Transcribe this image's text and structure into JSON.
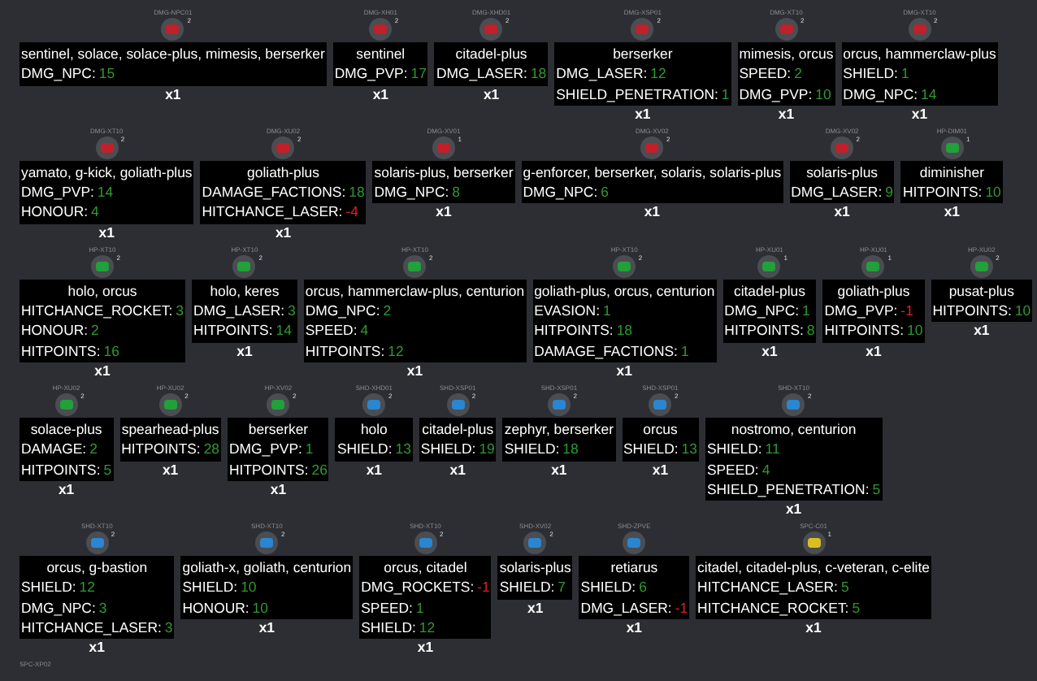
{
  "rows": [
    {
      "items": [
        {
          "code": "DMG-NPC01",
          "badge": "2",
          "color": "#c0202a",
          "title": "sentinel, solace, solace-plus, mimesis, berserker",
          "stats": [
            {
              "name": "DMG_NPC:",
              "value": "15",
              "negative": false
            }
          ],
          "quantity": "x1"
        },
        {
          "code": "DMG-XH01",
          "badge": "2",
          "color": "#c0202a",
          "title": "sentinel",
          "stats": [
            {
              "name": "DMG_PVP:",
              "value": "17",
              "negative": false
            }
          ],
          "quantity": "x1"
        },
        {
          "code": "DMG-XHD01",
          "badge": "2",
          "color": "#c0202a",
          "title": "citadel-plus",
          "stats": [
            {
              "name": "DMG_LASER:",
              "value": "18",
              "negative": false
            }
          ],
          "quantity": "x1"
        },
        {
          "code": "DMG-XSP01",
          "badge": "2",
          "color": "#c0202a",
          "title": "berserker",
          "stats": [
            {
              "name": "DMG_LASER:",
              "value": "12",
              "negative": false
            },
            {
              "name": "SHIELD_PENETRATION:",
              "value": "1",
              "negative": false
            }
          ],
          "quantity": "x1"
        },
        {
          "code": "DMG-XT10",
          "badge": "2",
          "color": "#c0202a",
          "title": "mimesis, orcus",
          "stats": [
            {
              "name": "SPEED:",
              "value": "2",
              "negative": false
            },
            {
              "name": "DMG_PVP:",
              "value": "10",
              "negative": false
            }
          ],
          "quantity": "x1"
        },
        {
          "code": "DMG-XT10",
          "badge": "2",
          "color": "#c0202a",
          "title": "orcus, hammerclaw-plus",
          "stats": [
            {
              "name": "SHIELD:",
              "value": "1",
              "negative": false
            },
            {
              "name": "DMG_NPC:",
              "value": "14",
              "negative": false
            }
          ],
          "quantity": "x1"
        }
      ]
    },
    {
      "items": [
        {
          "code": "DMG-XT10",
          "badge": "2",
          "color": "#c0202a",
          "title": "yamato, g-kick, goliath-plus",
          "stats": [
            {
              "name": "DMG_PVP:",
              "value": "14",
              "negative": false
            },
            {
              "name": "HONOUR:",
              "value": "4",
              "negative": false
            }
          ],
          "quantity": "x1"
        },
        {
          "code": "DMG-XU02",
          "badge": "2",
          "color": "#c0202a",
          "title": "goliath-plus",
          "stats": [
            {
              "name": "DAMAGE_FACTIONS:",
              "value": "18",
              "negative": false
            },
            {
              "name": "HITCHANCE_LASER:",
              "value": "-4",
              "negative": true
            }
          ],
          "quantity": "x1"
        },
        {
          "code": "DMG-XV01",
          "badge": "1",
          "color": "#c0202a",
          "title": "solaris-plus, berserker",
          "stats": [
            {
              "name": "DMG_NPC:",
              "value": "8",
              "negative": false
            }
          ],
          "quantity": "x1"
        },
        {
          "code": "DMG-XV02",
          "badge": "2",
          "color": "#c0202a",
          "title": "g-enforcer, berserker, solaris, solaris-plus",
          "stats": [
            {
              "name": "DMG_NPC:",
              "value": "6",
              "negative": false
            }
          ],
          "quantity": "x1"
        },
        {
          "code": "DMG-XV02",
          "badge": "2",
          "color": "#c0202a",
          "title": "solaris-plus",
          "stats": [
            {
              "name": "DMG_LASER:",
              "value": "9",
              "negative": false
            }
          ],
          "quantity": "x1"
        },
        {
          "code": "HP-DIM01",
          "badge": "1",
          "color": "#22a03a",
          "title": "diminisher",
          "stats": [
            {
              "name": "HITPOINTS:",
              "value": "10",
              "negative": false
            }
          ],
          "quantity": "x1"
        }
      ]
    },
    {
      "items": [
        {
          "code": "HP-XT10",
          "badge": "2",
          "color": "#22a03a",
          "title": "holo, orcus",
          "stats": [
            {
              "name": "HITCHANCE_ROCKET:",
              "value": "3",
              "negative": false
            },
            {
              "name": "HONOUR:",
              "value": "2",
              "negative": false
            },
            {
              "name": "HITPOINTS:",
              "value": "16",
              "negative": false
            }
          ],
          "quantity": "x1"
        },
        {
          "code": "HP-XT10",
          "badge": "2",
          "color": "#22a03a",
          "title": "holo, keres",
          "stats": [
            {
              "name": "DMG_LASER:",
              "value": "3",
              "negative": false
            },
            {
              "name": "HITPOINTS:",
              "value": "14",
              "negative": false
            }
          ],
          "quantity": "x1"
        },
        {
          "code": "HP-XT10",
          "badge": "2",
          "color": "#22a03a",
          "title": "orcus, hammerclaw-plus, centurion",
          "stats": [
            {
              "name": "DMG_NPC:",
              "value": "2",
              "negative": false
            },
            {
              "name": "SPEED:",
              "value": "4",
              "negative": false
            },
            {
              "name": "HITPOINTS:",
              "value": "12",
              "negative": false
            }
          ],
          "quantity": "x1"
        },
        {
          "code": "HP-XT10",
          "badge": "2",
          "color": "#22a03a",
          "title": "goliath-plus, orcus, centurion",
          "stats": [
            {
              "name": "EVASION:",
              "value": "1",
              "negative": false
            },
            {
              "name": "HITPOINTS:",
              "value": "18",
              "negative": false
            },
            {
              "name": "DAMAGE_FACTIONS:",
              "value": "1",
              "negative": false
            }
          ],
          "quantity": "x1"
        },
        {
          "code": "HP-XU01",
          "badge": "1",
          "color": "#22a03a",
          "title": "citadel-plus",
          "stats": [
            {
              "name": "DMG_NPC:",
              "value": "1",
              "negative": false
            },
            {
              "name": "HITPOINTS:",
              "value": "8",
              "negative": false
            }
          ],
          "quantity": "x1"
        },
        {
          "code": "HP-XU01",
          "badge": "1",
          "color": "#22a03a",
          "title": "goliath-plus",
          "stats": [
            {
              "name": "DMG_PVP:",
              "value": "-1",
              "negative": true
            },
            {
              "name": "HITPOINTS:",
              "value": "10",
              "negative": false
            }
          ],
          "quantity": "x1"
        },
        {
          "code": "HP-XU02",
          "badge": "2",
          "color": "#22a03a",
          "title": "pusat-plus",
          "stats": [
            {
              "name": "HITPOINTS:",
              "value": "10",
              "negative": false
            }
          ],
          "quantity": "x1"
        }
      ]
    },
    {
      "items": [
        {
          "code": "HP-XU02",
          "badge": "2",
          "color": "#22a03a",
          "title": "solace-plus",
          "stats": [
            {
              "name": "DAMAGE:",
              "value": "2",
              "negative": false
            },
            {
              "name": "HITPOINTS:",
              "value": "5",
              "negative": false
            }
          ],
          "quantity": "x1"
        },
        {
          "code": "HP-XU02",
          "badge": "2",
          "color": "#22a03a",
          "title": "spearhead-plus",
          "stats": [
            {
              "name": "HITPOINTS:",
              "value": "28",
              "negative": false
            }
          ],
          "quantity": "x1"
        },
        {
          "code": "HP-XV02",
          "badge": "2",
          "color": "#22a03a",
          "title": "berserker",
          "stats": [
            {
              "name": "DMG_PVP:",
              "value": "1",
              "negative": false
            },
            {
              "name": "HITPOINTS:",
              "value": "26",
              "negative": false
            }
          ],
          "quantity": "x1"
        },
        {
          "code": "SHD-XHD01",
          "badge": "2",
          "color": "#2a86d0",
          "title": "holo",
          "stats": [
            {
              "name": "SHIELD:",
              "value": "13",
              "negative": false
            }
          ],
          "quantity": "x1"
        },
        {
          "code": "SHD-XSP01",
          "badge": "2",
          "color": "#2a86d0",
          "title": "citadel-plus",
          "stats": [
            {
              "name": "SHIELD:",
              "value": "19",
              "negative": false
            }
          ],
          "quantity": "x1"
        },
        {
          "code": "SHD-XSP01",
          "badge": "2",
          "color": "#2a86d0",
          "title": "zephyr, berserker",
          "stats": [
            {
              "name": "SHIELD:",
              "value": "18",
              "negative": false
            }
          ],
          "quantity": "x1"
        },
        {
          "code": "SHD-XSP01",
          "badge": "2",
          "color": "#2a86d0",
          "title": "orcus",
          "stats": [
            {
              "name": "SHIELD:",
              "value": "13",
              "negative": false
            }
          ],
          "quantity": "x1"
        },
        {
          "code": "SHD-XT10",
          "badge": "2",
          "color": "#2a86d0",
          "title": "nostromo, centurion",
          "stats": [
            {
              "name": "SHIELD:",
              "value": "11",
              "negative": false
            },
            {
              "name": "SPEED:",
              "value": "4",
              "negative": false
            },
            {
              "name": "SHIELD_PENETRATION:",
              "value": "5",
              "negative": false
            }
          ],
          "quantity": "x1"
        }
      ]
    },
    {
      "items": [
        {
          "code": "SHD-XT10",
          "badge": "2",
          "color": "#2a86d0",
          "title": "orcus, g-bastion",
          "stats": [
            {
              "name": "SHIELD:",
              "value": "12",
              "negative": false
            },
            {
              "name": "DMG_NPC:",
              "value": "3",
              "negative": false
            },
            {
              "name": "HITCHANCE_LASER:",
              "value": "3",
              "negative": false
            }
          ],
          "quantity": "x1"
        },
        {
          "code": "SHD-XT10",
          "badge": "2",
          "color": "#2a86d0",
          "title": "goliath-x, goliath, centurion",
          "stats": [
            {
              "name": "SHIELD:",
              "value": "10",
              "negative": false
            },
            {
              "name": "HONOUR:",
              "value": "10",
              "negative": false
            }
          ],
          "quantity": "x1"
        },
        {
          "code": "SHD-XT10",
          "badge": "2",
          "color": "#2a86d0",
          "title": "orcus, citadel",
          "stats": [
            {
              "name": "DMG_ROCKETS:",
              "value": "-1",
              "negative": true
            },
            {
              "name": "SPEED:",
              "value": "1",
              "negative": false
            },
            {
              "name": "SHIELD:",
              "value": "12",
              "negative": false
            }
          ],
          "quantity": "x1"
        },
        {
          "code": "SHD-XV02",
          "badge": "2",
          "color": "#2a86d0",
          "title": "solaris-plus",
          "stats": [
            {
              "name": "SHIELD:",
              "value": "7",
              "negative": false
            }
          ],
          "quantity": "x1"
        },
        {
          "code": "SHD-ZPVE",
          "color": "#2a86d0",
          "title": "retiarus",
          "stats": [
            {
              "name": "SHIELD:",
              "value": "6",
              "negative": false
            },
            {
              "name": "DMG_LASER:",
              "value": "-1",
              "negative": true
            }
          ],
          "quantity": "x1"
        },
        {
          "code": "SPC-C01",
          "badge": "1",
          "color": "#d8c020",
          "title": "citadel, citadel-plus, c-veteran, c-elite",
          "stats": [
            {
              "name": "HITCHANCE_LASER:",
              "value": "5",
              "negative": false
            },
            {
              "name": "HITCHANCE_ROCKET:",
              "value": "5",
              "negative": false
            }
          ],
          "quantity": "x1"
        }
      ]
    },
    {
      "items": [
        {
          "code": "SPC-XP02"
        }
      ]
    }
  ]
}
